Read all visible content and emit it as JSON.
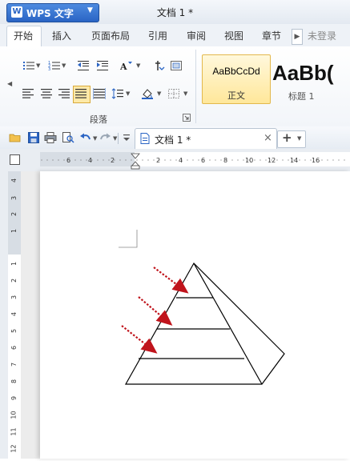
{
  "app": {
    "button_label": "WPS 文字",
    "logo_letter": "W"
  },
  "window": {
    "title": "文档 1 *"
  },
  "tabs": [
    {
      "label": "开始",
      "active": true
    },
    {
      "label": "插入"
    },
    {
      "label": "页面布局"
    },
    {
      "label": "引用"
    },
    {
      "label": "审阅"
    },
    {
      "label": "视图"
    },
    {
      "label": "章节"
    }
  ],
  "user": {
    "status": "未登录"
  },
  "ribbon": {
    "group_label": "段落",
    "styles": [
      {
        "sample": "AaBbCcDd",
        "name": "正文",
        "selected": true
      },
      {
        "sample": "AaBb(",
        "name": "标题 1"
      }
    ]
  },
  "document_tab": {
    "label": "文档 1 *"
  },
  "ruler": {
    "horizontal_labels": [
      "6",
      "4",
      "2",
      "2",
      "4",
      "6",
      "8",
      "10",
      "12",
      "14",
      "16"
    ],
    "vertical_labels_top": [
      "4",
      "3",
      "2",
      "1"
    ],
    "vertical_labels_bottom": [
      "1",
      "2",
      "3",
      "4",
      "5",
      "6",
      "7",
      "8",
      "9",
      "10",
      "11",
      "12"
    ]
  },
  "colors": {
    "accent": "#2a64c4",
    "arrow": "#c0141c",
    "selected_style": "#ffe79a"
  }
}
